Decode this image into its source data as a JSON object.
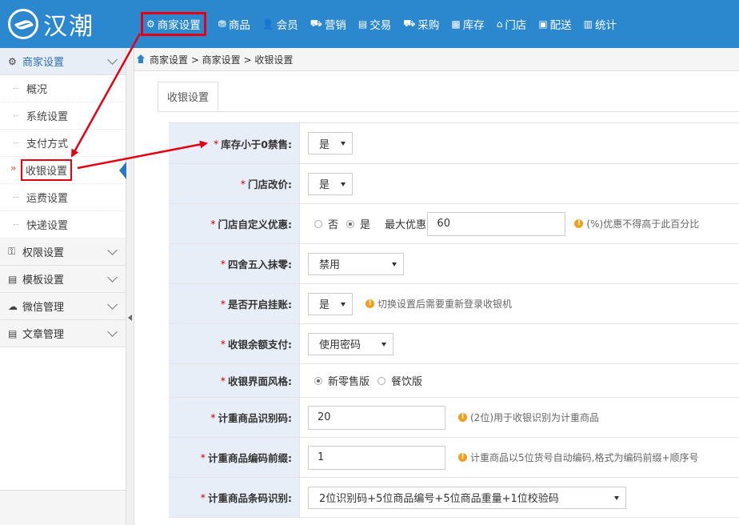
{
  "brand": {
    "name": "汉潮"
  },
  "nav": [
    {
      "label": "商家设置",
      "icon": "gear-icon",
      "glyph": "⚙",
      "active": true
    },
    {
      "label": "商品",
      "icon": "goods-icon",
      "glyph": "⛃",
      "active": false
    },
    {
      "label": "会员",
      "icon": "user-icon",
      "glyph": "👤",
      "active": false
    },
    {
      "label": "营销",
      "icon": "marketing-icon",
      "glyph": "⛟",
      "active": false
    },
    {
      "label": "交易",
      "icon": "trade-icon",
      "glyph": "▤",
      "active": false
    },
    {
      "label": "采购",
      "icon": "purchase-icon",
      "glyph": "⛟",
      "active": false
    },
    {
      "label": "库存",
      "icon": "stock-icon",
      "glyph": "▦",
      "active": false
    },
    {
      "label": "门店",
      "icon": "store-icon",
      "glyph": "⌂",
      "active": false
    },
    {
      "label": "配送",
      "icon": "delivery-icon",
      "glyph": "▣",
      "active": false
    },
    {
      "label": "统计",
      "icon": "stats-icon",
      "glyph": "▥",
      "active": false
    }
  ],
  "sidebar": {
    "group_main": {
      "label": "商家设置",
      "icon": "gear-icon",
      "glyph": "⚙"
    },
    "items": [
      {
        "label": "概况",
        "active": false
      },
      {
        "label": "系统设置",
        "active": false
      },
      {
        "label": "支付方式",
        "active": false
      },
      {
        "label": "收银设置",
        "active": true
      },
      {
        "label": "运费设置",
        "active": false
      },
      {
        "label": "快递设置",
        "active": false
      }
    ],
    "groups": [
      {
        "label": "权限设置",
        "icon": "key-icon",
        "glyph": "⚿"
      },
      {
        "label": "模板设置",
        "icon": "template-icon",
        "glyph": "▤"
      },
      {
        "label": "微信管理",
        "icon": "wechat-icon",
        "glyph": "☁"
      },
      {
        "label": "文章管理",
        "icon": "article-icon",
        "glyph": "▤"
      }
    ],
    "active_marker": "»"
  },
  "breadcrumb": "商家设置 > 商家设置 > 收银设置",
  "tab": {
    "label": "收银设置"
  },
  "form": {
    "stock_zero": {
      "label": "库存小于0禁售:",
      "value": "是"
    },
    "store_price": {
      "label": "门店改价:",
      "value": "是"
    },
    "custom_discount": {
      "label": "门店自定义优惠:",
      "opt_no": "否",
      "opt_yes": "是",
      "max_label": "最大优惠:",
      "max_value": "60",
      "hint": "(%)优惠不得高于此百分比"
    },
    "rounding": {
      "label": "四舍五入抹零:",
      "value": "禁用"
    },
    "hang_order": {
      "label": "是否开启挂账:",
      "value": "是",
      "hint": "切换设置后需要重新登录收银机"
    },
    "balance_pay": {
      "label": "收银余额支付:",
      "value": "使用密码"
    },
    "ui_style": {
      "label": "收银界面风格:",
      "opt_retail": "新零售版",
      "opt_food": "餐饮版"
    },
    "weight_code": {
      "label": "计重商品识别码:",
      "value": "20",
      "hint": "(2位)用于收银识别为计重商品"
    },
    "weight_prefix": {
      "label": "计重商品编码前缀:",
      "value": "1",
      "hint": "计重商品以5位货号自动编码,格式为编码前缀+顺序号"
    },
    "weight_barcode": {
      "label": "计重商品条码识别:",
      "value": "2位识别码+5位商品编号+5位商品重量+1位校验码"
    }
  },
  "hint_glyph": "!",
  "required_mark": "*",
  "colors": {
    "topbar": "#2b88cf",
    "annotation": "#e60012",
    "label_bg": "#e7eef7"
  }
}
